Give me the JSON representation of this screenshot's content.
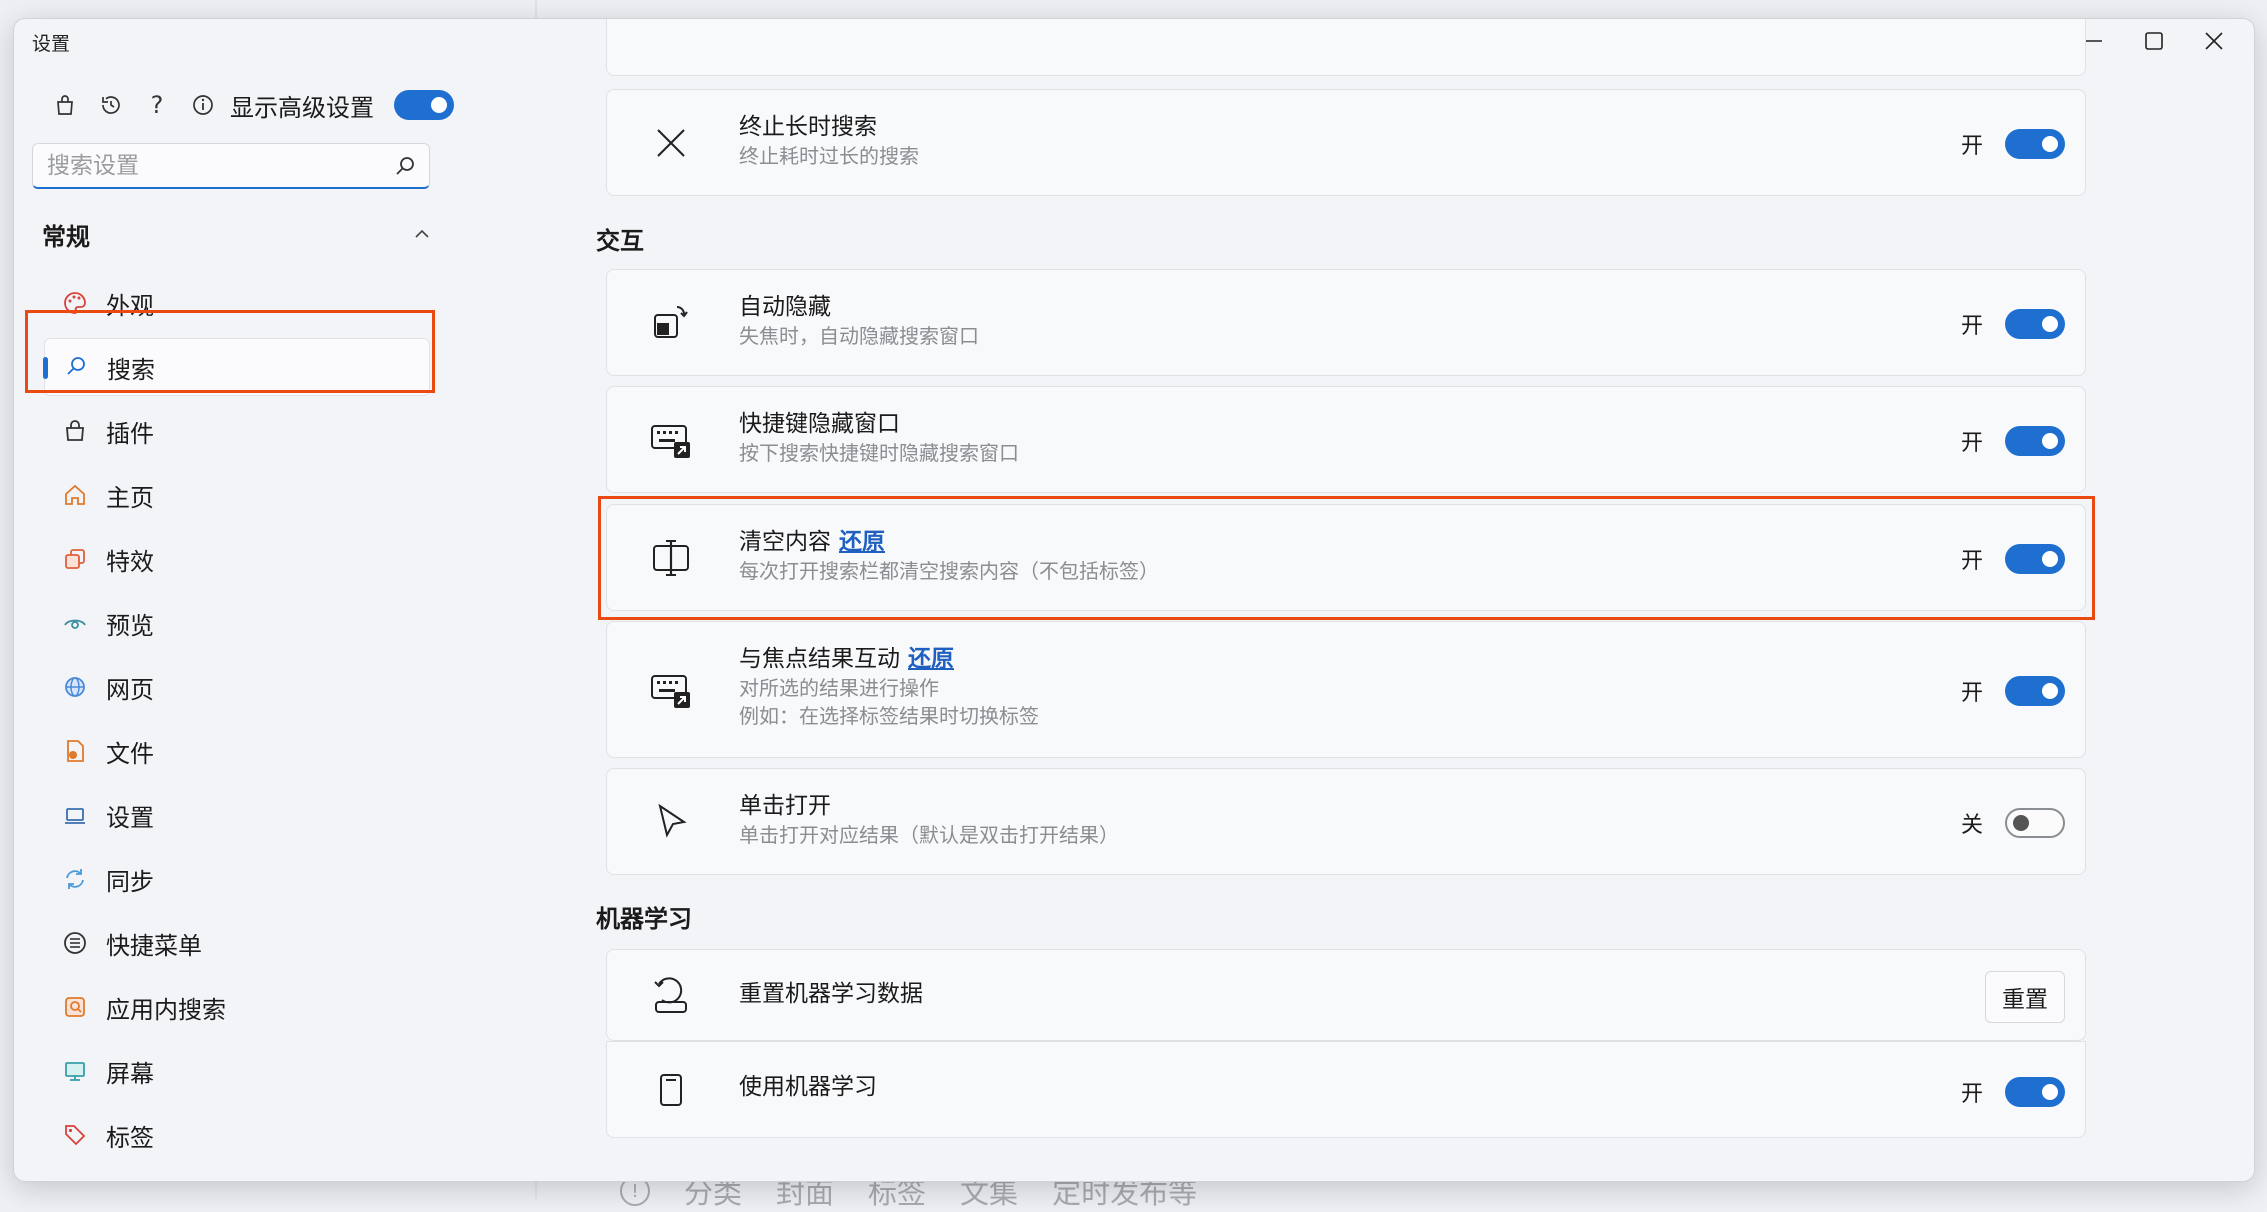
{
  "window": {
    "title": "设置"
  },
  "sidebar": {
    "advanced_label": "显示高级设置",
    "advanced_on": true,
    "search_placeholder": "搜索设置",
    "section": "常规",
    "items": [
      {
        "label": "外观",
        "icon": "palette-icon"
      },
      {
        "label": "搜索",
        "icon": "search-icon",
        "selected": true
      },
      {
        "label": "插件",
        "icon": "bag-icon"
      },
      {
        "label": "主页",
        "icon": "home-icon"
      },
      {
        "label": "特效",
        "icon": "effects-icon"
      },
      {
        "label": "预览",
        "icon": "eye-icon"
      },
      {
        "label": "网页",
        "icon": "globe-icon"
      },
      {
        "label": "文件",
        "icon": "file-icon"
      },
      {
        "label": "设置",
        "icon": "laptop-icon"
      },
      {
        "label": "同步",
        "icon": "sync-icon"
      },
      {
        "label": "快捷菜单",
        "icon": "menu-icon"
      },
      {
        "label": "应用内搜索",
        "icon": "app-search-icon"
      },
      {
        "label": "屏幕",
        "icon": "screen-icon"
      },
      {
        "label": "标签",
        "icon": "tag-icon"
      }
    ]
  },
  "content": {
    "stop_search": {
      "title": "终止长时搜索",
      "desc": "终止耗时过长的搜索",
      "state": "开"
    },
    "interaction_title": "交互",
    "auto_hide": {
      "title": "自动隐藏",
      "desc": "失焦时，自动隐藏搜索窗口",
      "state": "开"
    },
    "hotkey_hide": {
      "title": "快捷键隐藏窗口",
      "desc": "按下搜索快捷键时隐藏搜索窗口",
      "state": "开"
    },
    "clear_content": {
      "title": "清空内容",
      "restore": "还原",
      "desc": "每次打开搜索栏都清空搜索内容（不包括标签）",
      "state": "开"
    },
    "focus_interact": {
      "title": "与焦点结果互动",
      "restore": "还原",
      "desc": "对所选的结果进行操作",
      "desc2": "例如：在选择标签结果时切换标签",
      "state": "开"
    },
    "single_click": {
      "title": "单击打开",
      "desc": "单击打开对应结果（默认是双击打开结果）",
      "state": "关"
    },
    "ml_title": "机器学习",
    "ml_reset": {
      "title": "重置机器学习数据",
      "button": "重置"
    },
    "ml_use": {
      "title": "使用机器学习",
      "state": "开"
    }
  },
  "background": {
    "footer_items": [
      "分类",
      "封面",
      "标签",
      "文集",
      "定时发布等"
    ]
  }
}
